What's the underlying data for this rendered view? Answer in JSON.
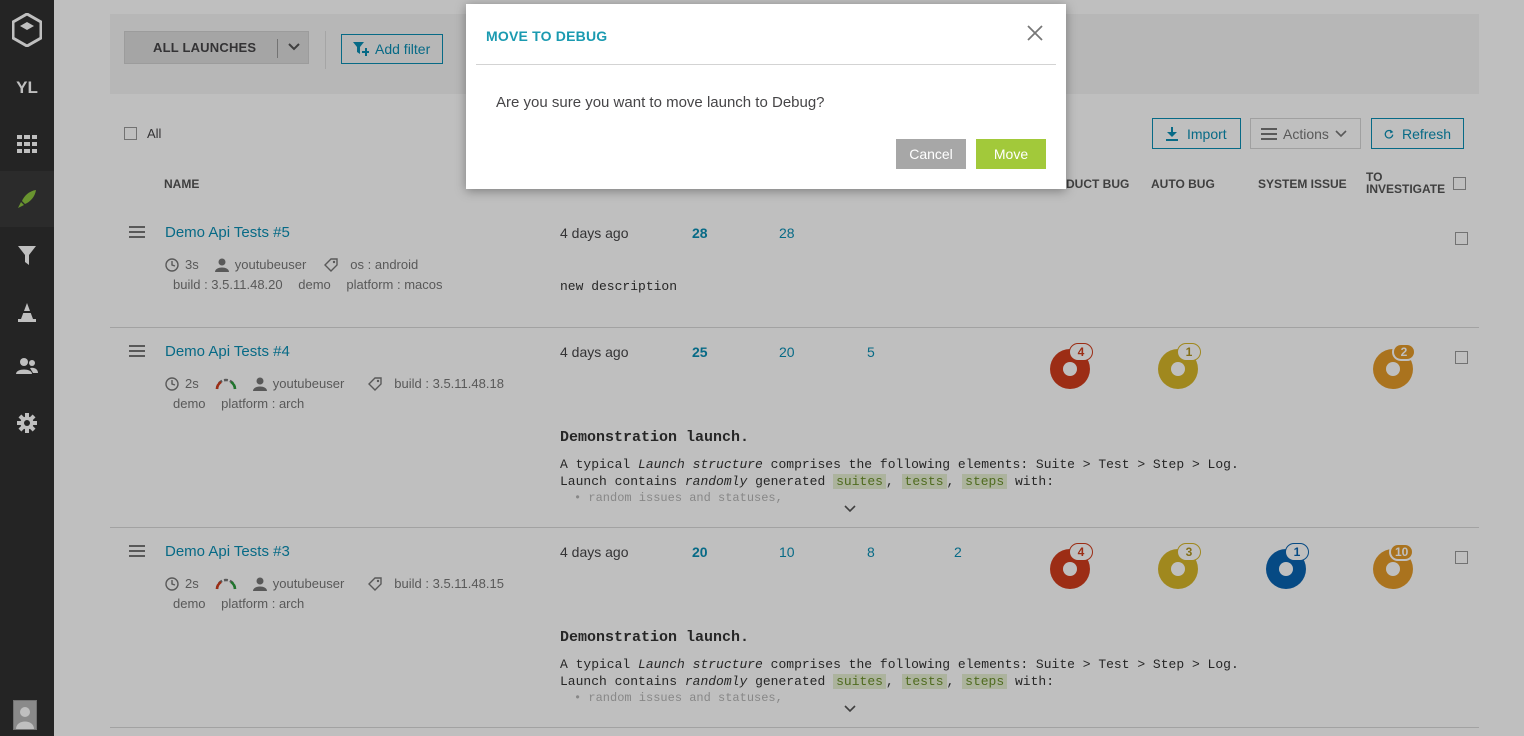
{
  "sidebar": {
    "user_initials": "YL",
    "items": [
      {
        "icon": "logo-icon"
      },
      {
        "icon": "dashboard-grid-icon"
      },
      {
        "icon": "launches-rocket-icon"
      },
      {
        "icon": "filters-funnel-icon"
      },
      {
        "icon": "debug-cone-icon"
      },
      {
        "icon": "members-icon"
      },
      {
        "icon": "settings-gear-icon"
      }
    ]
  },
  "filterbar": {
    "launches_select": "ALL LAUNCHES",
    "add_filter": "Add filter"
  },
  "toolbar": {
    "select_all": "All",
    "import": "Import",
    "actions": "Actions",
    "refresh": "Refresh"
  },
  "columns": {
    "name": "NAME",
    "product_bug": "DUCT BUG",
    "auto_bug": "AUTO BUG",
    "system_issue": "SYSTEM ISSUE",
    "to_investigate_1": "TO",
    "to_investigate_2": "INVESTIGATE"
  },
  "launches": [
    {
      "name": "Demo Api Tests #5",
      "duration": "3s",
      "owner": "youtubeuser",
      "attr1": "os : android",
      "line2": [
        "build : 3.5.11.48.20",
        "demo",
        "platform : macos"
      ],
      "time": "4 days ago",
      "total": "28",
      "passed": "28",
      "description": "new description"
    },
    {
      "name": "Demo Api Tests #4",
      "duration": "2s",
      "owner": "youtubeuser",
      "attr1": "build : 3.5.11.48.18",
      "line2": [
        "demo",
        "platform : arch"
      ],
      "time": "4 days ago",
      "total": "25",
      "passed": "20",
      "failed": "5",
      "desc_title": "Demonstration launch.",
      "desc_l1a": "A typical",
      "desc_l1b": "Launch structure",
      "desc_l1c": "comprises the following elements: Suite > Test > Step > Log.",
      "desc_l2a": "Launch contains",
      "desc_l2b": "randomly",
      "desc_l2c": "generated",
      "tag_suites": "suites",
      "tag_tests": "tests",
      "tag_steps": "steps",
      "desc_l2d": "with:",
      "desc_l3": "• random issues and statuses,",
      "defects": {
        "product_bug": "4",
        "auto_bug": "1",
        "to_investigate": "2"
      }
    },
    {
      "name": "Demo Api Tests #3",
      "duration": "2s",
      "owner": "youtubeuser",
      "attr1": "build : 3.5.11.48.15",
      "line2": [
        "demo",
        "platform : arch"
      ],
      "time": "4 days ago",
      "total": "20",
      "passed": "10",
      "failed": "8",
      "skipped": "2",
      "desc_title": "Demonstration launch.",
      "desc_l1a": "A typical",
      "desc_l1b": "Launch structure",
      "desc_l1c": "comprises the following elements: Suite > Test > Step > Log.",
      "desc_l2a": "Launch contains",
      "desc_l2b": "randomly",
      "desc_l2c": "generated",
      "tag_suites": "suites",
      "tag_tests": "tests",
      "tag_steps": "steps",
      "desc_l2d": "with:",
      "desc_l3": "• random issues and statuses,",
      "defects": {
        "product_bug": "4",
        "auto_bug": "3",
        "system_issue": "1",
        "to_investigate": "10"
      }
    }
  ],
  "colors": {
    "accent": "#0a8eb3",
    "product_bug": "#d03d1c",
    "auto_bug": "#d6b628",
    "system_issue": "#0963b0",
    "to_investigate": "#e39a29",
    "move_button": "#a2c93a"
  },
  "modal": {
    "title": "MOVE TO DEBUG",
    "message": "Are you sure you want to move launch to Debug?",
    "cancel": "Cancel",
    "move": "Move"
  }
}
